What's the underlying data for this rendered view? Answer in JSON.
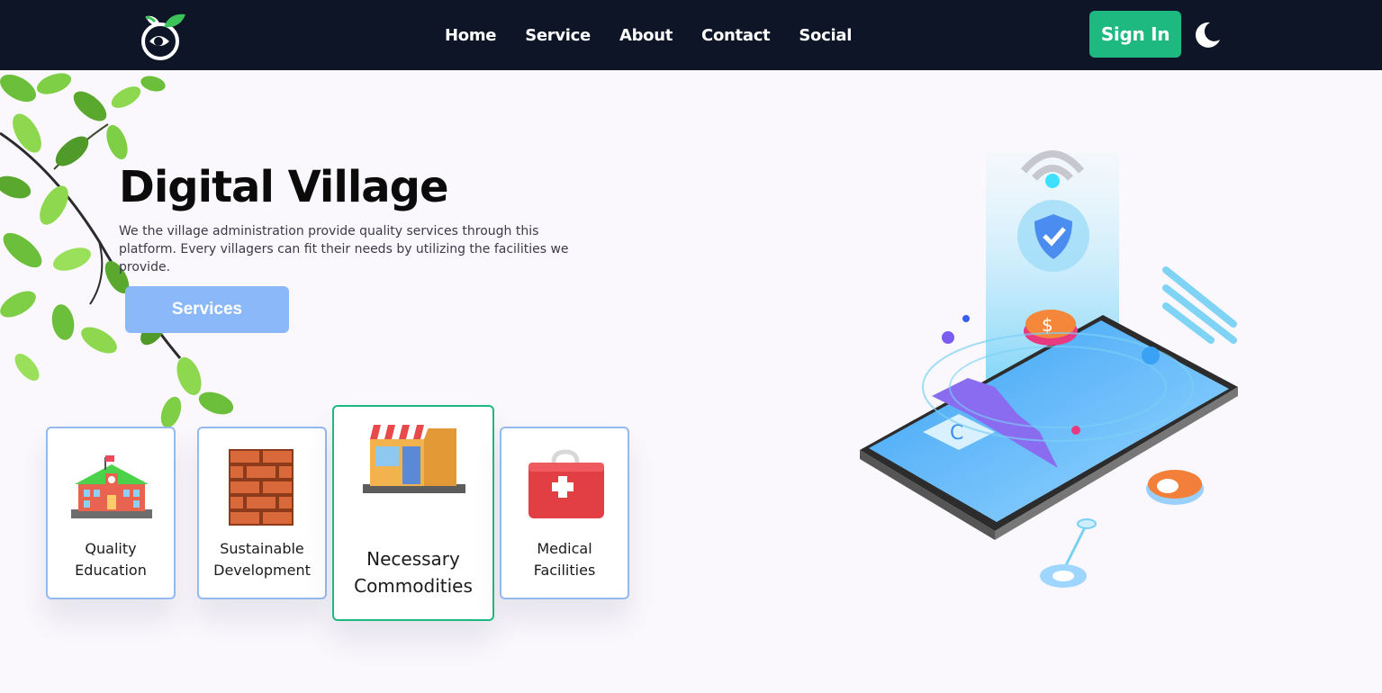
{
  "nav": {
    "links": [
      {
        "label": "Home"
      },
      {
        "label": "Service"
      },
      {
        "label": "About"
      },
      {
        "label": "Contact"
      },
      {
        "label": "Social"
      }
    ],
    "signin_label": "Sign In",
    "theme_icon": "moon-icon",
    "logo_icon": "village-logo-icon"
  },
  "hero": {
    "title": "Digital Village",
    "description": "We the village administration provide quality services through this platform. Every villagers can fit their needs by utilizing the facilities we provide.",
    "cta_label": "Services"
  },
  "cards": [
    {
      "line1": "Quality",
      "line2": "Education",
      "icon": "school-icon"
    },
    {
      "line1": "Sustainable",
      "line2": "Development",
      "icon": "brick-wall-icon"
    },
    {
      "line1": "Necessary",
      "line2": "Commodities",
      "icon": "shop-icon"
    },
    {
      "line1": "Medical",
      "line2": "Facilities",
      "icon": "medical-kit-icon"
    }
  ],
  "colors": {
    "navbar_bg": "#0d1527",
    "accent_green": "#1db981",
    "services_button": "#8ab8f8",
    "card_border": "#93b9ee",
    "page_bg": "#faf8fc"
  }
}
